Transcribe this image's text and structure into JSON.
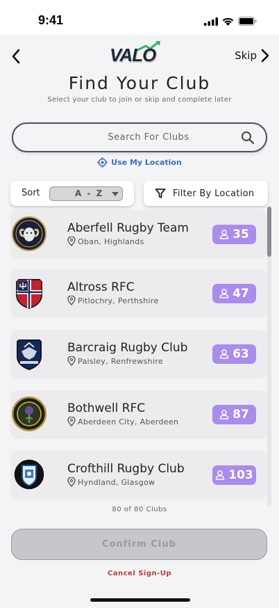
{
  "status_bar": {
    "time": "9:41"
  },
  "header": {
    "logo_text": "VALO",
    "skip_label": "Skip"
  },
  "page": {
    "title": "Find Your Club",
    "subtitle": "Select your club to join or skip and complete later"
  },
  "search": {
    "placeholder": "Search For Clubs"
  },
  "use_location_label": "Use My Location",
  "sort": {
    "label": "Sort",
    "selected": "A - Z"
  },
  "filter": {
    "label": "Filter By Location"
  },
  "clubs": [
    {
      "name": "Aberfell Rugby Team",
      "location": "Oban, Highlands",
      "members": "35",
      "crest": "ram-crest-icon"
    },
    {
      "name": "Altross RFC",
      "location": "Pitlochry, Perthshire",
      "members": "47",
      "crest": "trident-shield-icon"
    },
    {
      "name": "Barcraig Rugby Club",
      "location": "Paisley, Renfrewshire",
      "members": "63",
      "crest": "eagle-shield-icon"
    },
    {
      "name": "Bothwell RFC",
      "location": "Aberdeen City, Aberdeen",
      "members": "87",
      "crest": "thistle-crest-icon"
    },
    {
      "name": "Crofthill Rugby Club",
      "location": "Hyndland, Glasgow",
      "members": "103",
      "crest": "lion-shield-icon"
    }
  ],
  "club_count_label": "80 of 80 Clubs",
  "confirm_label": "Confirm Club",
  "cancel_label": "Cancel Sign-Up",
  "colors": {
    "accent_purple": "#a98cee",
    "link_blue": "#3b6fc4",
    "cancel_red": "#c23a3a",
    "logo_green": "#2fb66a"
  }
}
